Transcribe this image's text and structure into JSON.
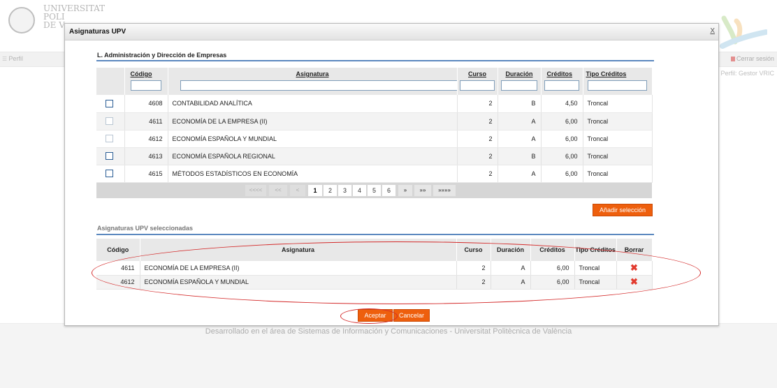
{
  "background": {
    "logo_lines": [
      "UNIVERSITAT",
      "POLI",
      "DE V"
    ],
    "nav_perfil": "Perfil",
    "nav_logout": "Cerrar sesión",
    "role": "Perfil: Gestor VRIC",
    "footer": "Desarrollado en el área de Sistemas de Información y Comunicaciones - Universitat Politècnica de València"
  },
  "dialog": {
    "title": "Asignaturas UPV",
    "close_label": "X",
    "section_title": "L. Administración y Dirección de Empresas",
    "search_table": {
      "headers": {
        "codigo": "Código",
        "asignatura": "Asignatura",
        "curso": "Curso",
        "duracion": "Duración",
        "creditos": "Créditos",
        "tipo": "Tipo Créditos"
      },
      "rows": [
        {
          "checkbox_enabled": true,
          "codigo": "4608",
          "asignatura": "CONTABILIDAD ANALÍTICA",
          "curso": "2",
          "duracion": "B",
          "creditos": "4,50",
          "tipo": "Troncal"
        },
        {
          "checkbox_enabled": false,
          "codigo": "4611",
          "asignatura": "ECONOMÍA DE LA EMPRESA (II)",
          "curso": "2",
          "duracion": "A",
          "creditos": "6,00",
          "tipo": "Troncal"
        },
        {
          "checkbox_enabled": false,
          "codigo": "4612",
          "asignatura": "ECONOMÍA ESPAÑOLA Y MUNDIAL",
          "curso": "2",
          "duracion": "A",
          "creditos": "6,00",
          "tipo": "Troncal"
        },
        {
          "checkbox_enabled": true,
          "codigo": "4613",
          "asignatura": "ECONOMÍA ESPAÑOLA REGIONAL",
          "curso": "2",
          "duracion": "B",
          "creditos": "6,00",
          "tipo": "Troncal"
        },
        {
          "checkbox_enabled": true,
          "codigo": "4615",
          "asignatura": "MÉTODOS ESTADÍSTICOS EN ECONOMÍA",
          "curso": "2",
          "duracion": "A",
          "creditos": "6,00",
          "tipo": "Troncal"
        }
      ]
    },
    "pager": {
      "first": "<<<<",
      "prev_block": "<<",
      "prev": "<",
      "pages": [
        "1",
        "2",
        "3",
        "4",
        "5",
        "6"
      ],
      "current_page": "1",
      "next": "»",
      "next_block": "»»",
      "last": "»»»»"
    },
    "add_button": "Añadir selección",
    "selected_title": "Asignaturas UPV seleccionadas",
    "selected_table": {
      "headers": {
        "codigo": "Código",
        "asignatura": "Asignatura",
        "curso": "Curso",
        "duracion": "Duración",
        "creditos": "Créditos",
        "tipo": "Tipo Créditos",
        "borrar": "Borrar"
      },
      "rows": [
        {
          "codigo": "4611",
          "asignatura": "ECONOMÍA DE LA EMPRESA (II)",
          "curso": "2",
          "duracion": "A",
          "creditos": "6,00",
          "tipo": "Troncal",
          "borrar": "✖"
        },
        {
          "codigo": "4612",
          "asignatura": "ECONOMÍA ESPAÑOLA Y MUNDIAL",
          "curso": "2",
          "duracion": "A",
          "creditos": "6,00",
          "tipo": "Troncal",
          "borrar": "✖"
        }
      ]
    },
    "accept_button": "Aceptar",
    "cancel_button": "Cancelar"
  },
  "colors": {
    "accent_orange": "#ee5f0d",
    "section_rule_blue": "#5b88bf",
    "annotation_red": "#d42a2a",
    "delete_red": "#e23b2f"
  }
}
